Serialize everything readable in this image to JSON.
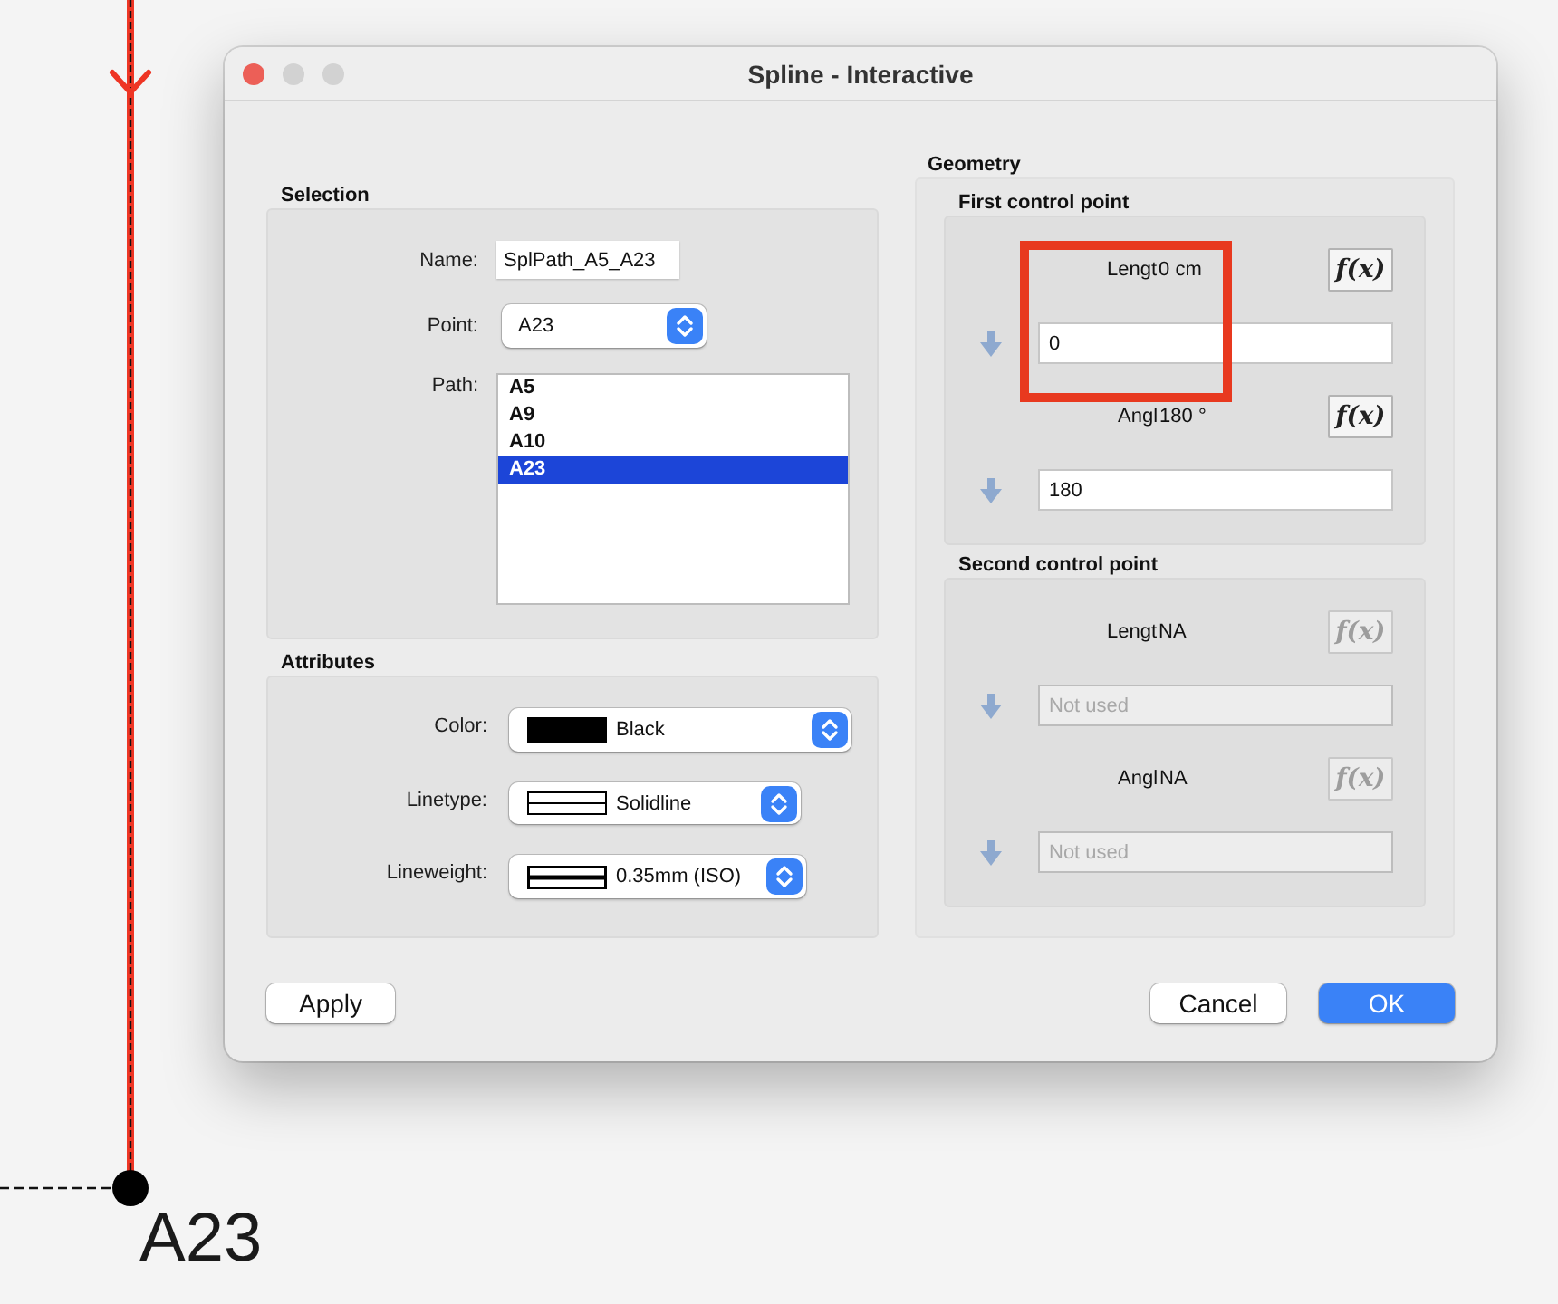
{
  "canvas": {
    "spline": {
      "selected": true
    },
    "point": {
      "label": "A23"
    }
  },
  "window": {
    "title": "Spline - Interactive"
  },
  "selection": {
    "title": "Selection",
    "name": {
      "label": "Name:",
      "value": "SplPath_A5_A23"
    },
    "point": {
      "label": "Point:",
      "value": "A23"
    },
    "path": {
      "label": "Path:",
      "items": [
        {
          "text": "A5",
          "selected": false
        },
        {
          "text": "A9",
          "selected": false
        },
        {
          "text": "A10",
          "selected": false
        },
        {
          "text": "A23",
          "selected": true
        }
      ]
    }
  },
  "attributes": {
    "title": "Attributes",
    "fields": [
      {
        "kind": "color",
        "label": "Color:",
        "value": "Black",
        "color": "#000000"
      },
      {
        "kind": "linetype",
        "label": "Linetype:",
        "value": "Solidline"
      },
      {
        "kind": "lineweight",
        "label": "Lineweight:",
        "value": "0.35mm (ISO)"
      }
    ]
  },
  "geometry": {
    "title": "Geometry",
    "groups": [
      {
        "title": "First control point",
        "rows": [
          {
            "label": "Lengt",
            "reading": "0 cm",
            "formula_button": "f(x)",
            "value": "0",
            "disabled": false,
            "highlighted": true
          },
          {
            "label": "Angl",
            "reading": "180 °",
            "formula_button": "f(x)",
            "value": "180",
            "disabled": false,
            "highlighted": false
          }
        ]
      },
      {
        "title": "Second control point",
        "rows": [
          {
            "label": "Lengt",
            "reading": "NA",
            "formula_button": "f(x)",
            "placeholder": "Not used",
            "disabled": true,
            "highlighted": false
          },
          {
            "label": "Angl",
            "reading": "NA",
            "formula_button": "f(x)",
            "placeholder": "Not used",
            "disabled": true,
            "highlighted": false
          }
        ]
      }
    ]
  },
  "footer": {
    "left_buttons": [
      {
        "label": "Apply",
        "kind": "push"
      }
    ],
    "right_buttons": [
      {
        "label": "Cancel",
        "kind": "push"
      },
      {
        "label": "OK",
        "kind": "default"
      }
    ]
  }
}
